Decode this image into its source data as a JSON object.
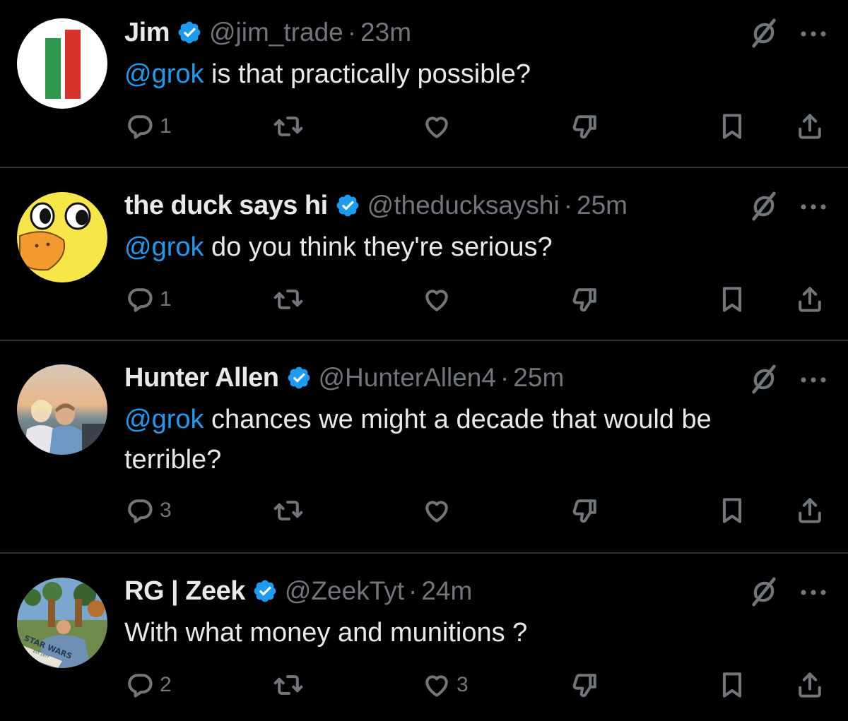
{
  "colors": {
    "background": "#000000",
    "text": "#e7e9ea",
    "muted": "#71767b",
    "accent": "#1d9bf0",
    "divider": "#2f3336"
  },
  "icons": {
    "verified": "verified-badge-icon",
    "grok": "grok-icon",
    "more": "more-options-icon",
    "reply": "reply-icon",
    "repost": "repost-icon",
    "like": "like-icon",
    "dislike": "dislike-icon",
    "bookmark": "bookmark-icon",
    "share": "share-icon"
  },
  "tweets": [
    {
      "name": "Jim",
      "handle": "@jim_trade",
      "sep": "·",
      "time": "23m",
      "mention": "@grok",
      "text": " is that practically possible?",
      "replies": "1",
      "likes": ""
    },
    {
      "name": "the duck says hi",
      "handle": "@theducksayshi",
      "sep": "·",
      "time": "25m",
      "mention": "@grok",
      "text": " do you think they're serious?",
      "replies": "1",
      "likes": ""
    },
    {
      "name": "Hunter Allen",
      "handle": "@HunterAllen4",
      "sep": "·",
      "time": "25m",
      "mention": "@grok",
      "text": " chances we might a decade that would be terrible?",
      "replies": "3",
      "likes": ""
    },
    {
      "name": "RG | Zeek",
      "handle": "@ZeekTyt",
      "sep": "·",
      "time": "24m",
      "mention": "",
      "text": "With what money and munitions ?",
      "replies": "2",
      "likes": "3"
    }
  ],
  "avatar_text": {
    "zeek_patch": "STAR WARS",
    "zeek_patch_sub": "EST 1977"
  }
}
